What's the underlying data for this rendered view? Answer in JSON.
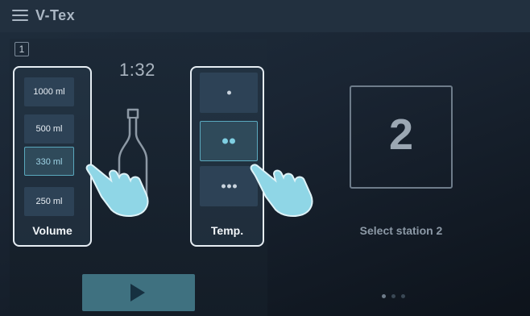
{
  "app": {
    "title": "V-Tex",
    "menu_icon": "hamburger-menu-icon"
  },
  "station_panel": {
    "station_number": "1",
    "timer": "1:32",
    "volume": {
      "label": "Volume",
      "options": [
        {
          "label": "1000 ml",
          "selected": false
        },
        {
          "label": "500 ml",
          "selected": false
        },
        {
          "label": "330 ml",
          "selected": true
        },
        {
          "label": "250 ml",
          "selected": false
        }
      ]
    },
    "temperature": {
      "label": "Temp.",
      "options": [
        {
          "level": 1,
          "selected": false
        },
        {
          "level": 2,
          "selected": true
        },
        {
          "level": 3,
          "selected": false
        }
      ]
    },
    "bottle_icon": "bottle-icon",
    "hand_icon": "pointing-hand-icon",
    "play_icon": "play-icon"
  },
  "station_select": {
    "number": "2",
    "caption": "Select station 2"
  },
  "pager": {
    "pages": 3,
    "active": 0
  },
  "colors": {
    "accent": "#5aa8bd",
    "play": "#3f7180",
    "hand": "#8fd6e6",
    "background": "#1a2533"
  }
}
